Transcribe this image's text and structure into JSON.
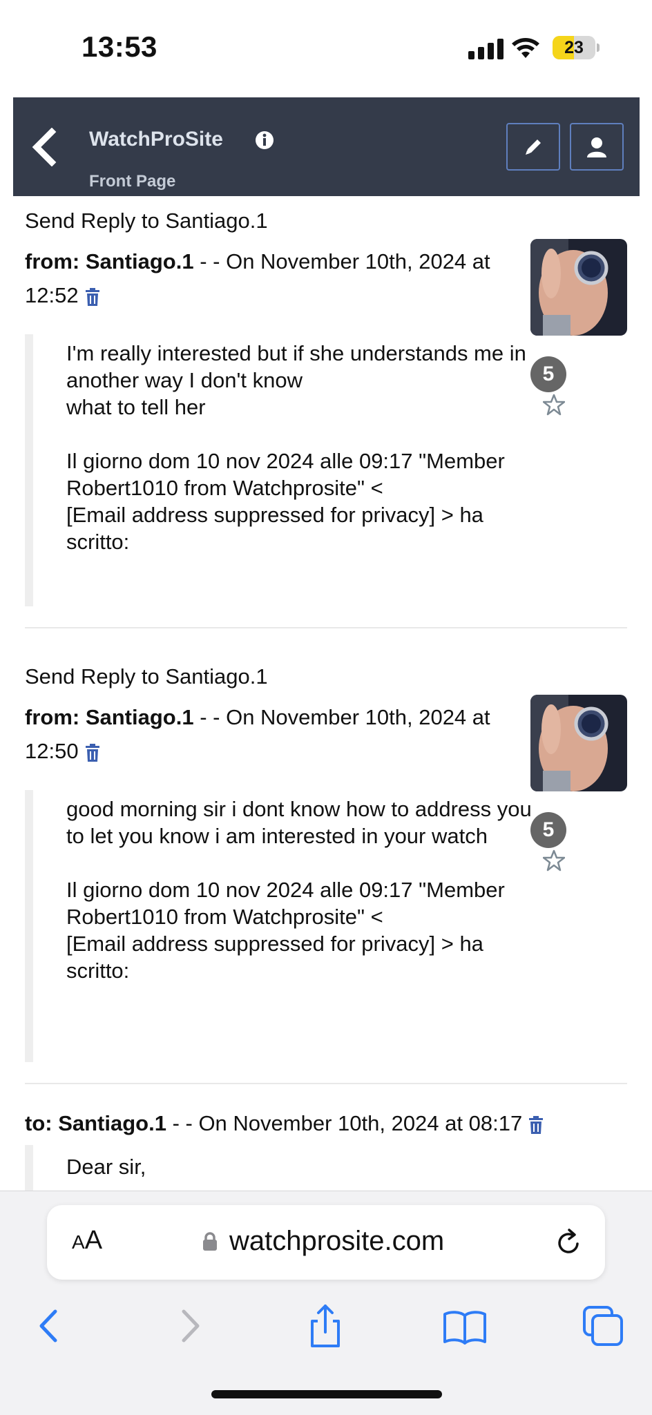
{
  "status_bar": {
    "time": "13:53",
    "battery": "23"
  },
  "header": {
    "site_title": "WatchProSite",
    "subtitle": "Front Page"
  },
  "posts": [
    {
      "reply_label": "Send Reply to Santiago.1",
      "from_prefix": "from: Santiago.1",
      "date_line": " - - On November 10th, 2024 at 12:52",
      "badge": "5",
      "body": "I'm really interested but if she understands me in another way I don't know\nwhat to tell her\n\nIl giorno dom 10 nov 2024 alle 09:17 \"Member Robert1010 from Watchprosite\" <\n[Email address suppressed for privacy] > ha scritto:"
    },
    {
      "reply_label": "Send Reply to Santiago.1",
      "from_prefix": "from: Santiago.1",
      "date_line": " - - On November 10th, 2024 at 12:50",
      "badge": "5",
      "body": "good morning sir i dont know how to address you to let you know i am interested in your watch\n\nIl giorno dom 10 nov 2024 alle 09:17 \"Member Robert1010 from Watchprosite\" <\n[Email address suppressed for privacy] > ha scritto:"
    },
    {
      "to_prefix": "to: Santiago.1",
      "date_line": " - - On November 10th, 2024 at 08:17",
      "body": "Dear sir,"
    }
  ],
  "browser": {
    "font_size_label": "AA",
    "url": "watchprosite.com"
  },
  "icons": {
    "back": "chevron-left-icon",
    "info": "info-icon",
    "edit": "pencil-icon",
    "profile": "user-icon",
    "delete": "trash-icon",
    "favorite": "star-icon",
    "lock": "lock-icon",
    "reload": "reload-icon",
    "share": "share-icon",
    "bookmarks": "book-icon",
    "tabs": "tabs-icon"
  },
  "colors": {
    "header_bg": "#343b4a",
    "accent": "#2e7cf6",
    "button_border": "#5f7fbe"
  }
}
